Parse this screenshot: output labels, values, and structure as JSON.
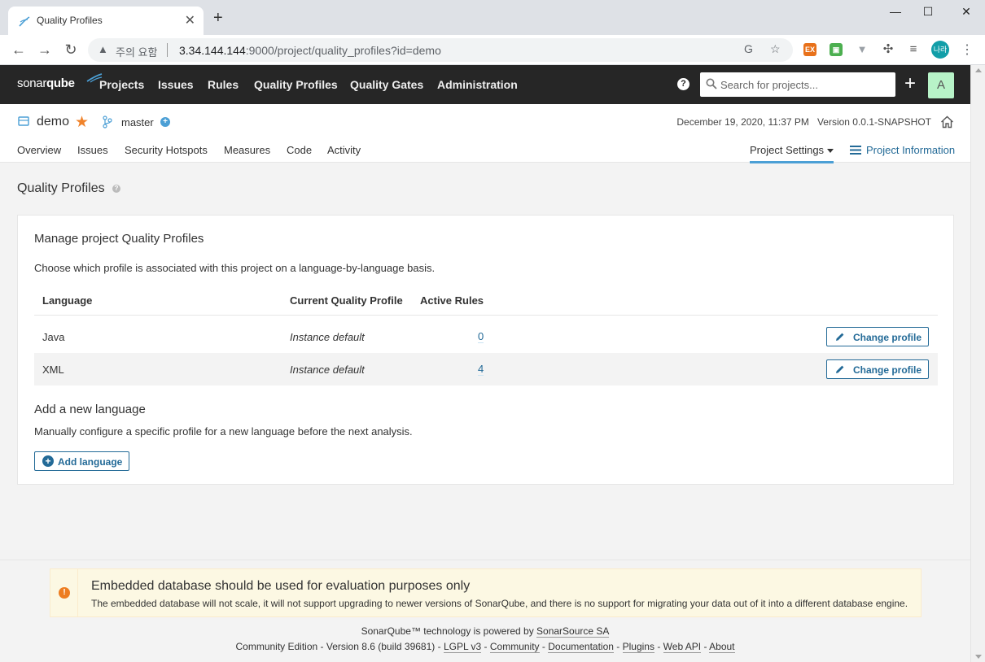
{
  "browser": {
    "tab_title": "Quality Profiles",
    "tab_close": "✕",
    "new_tab": "+",
    "window": {
      "minimize": "—",
      "maximize": "☐",
      "close": "✕"
    },
    "security_label": "주의 요함",
    "url_host": "3.34.144.144",
    "url_rest": ":9000/project/quality_profiles?id=demo",
    "profile_initials": "나라",
    "extensions": [
      {
        "name": "ex-extension-icon",
        "label": "EX",
        "color": "#e8711a"
      },
      {
        "name": "green-extension-icon",
        "label": "▣",
        "color": "#4caf50"
      },
      {
        "name": "vue-extension-icon",
        "label": "▼",
        "color": "#9aa0a6"
      }
    ]
  },
  "navbar": {
    "logo_text_a": "sonar",
    "logo_text_b": "qube",
    "items": [
      "Projects",
      "Issues",
      "Rules",
      "Quality Profiles",
      "Quality Gates",
      "Administration"
    ],
    "help_label": "?",
    "search_placeholder": "Search for projects...",
    "plus_label": "+",
    "avatar_letter": "A"
  },
  "project": {
    "name": "demo",
    "branch": "master",
    "date": "December 19, 2020, 11:37 PM",
    "version": "Version 0.0.1-SNAPSHOT",
    "tabs": [
      "Overview",
      "Issues",
      "Security Hotspots",
      "Measures",
      "Code",
      "Activity"
    ],
    "settings_label": "Project Settings",
    "info_label": "Project Information"
  },
  "page": {
    "title": "Quality Profiles",
    "card_title": "Manage project Quality Profiles",
    "card_desc": "Choose which profile is associated with this project on a language-by-language basis.",
    "columns": [
      "Language",
      "Current Quality Profile",
      "Active Rules"
    ],
    "rows": [
      {
        "language": "Java",
        "profile": "Instance default",
        "rules": "0",
        "action": "Change profile"
      },
      {
        "language": "XML",
        "profile": "Instance default",
        "rules": "4",
        "action": "Change profile"
      }
    ],
    "add_title": "Add a new language",
    "add_desc": "Manually configure a specific profile for a new language before the next analysis.",
    "add_button": "Add language"
  },
  "footer": {
    "warning_icon": "!",
    "warning_title": "Embedded database should be used for evaluation purposes only",
    "warning_text": "The embedded database will not scale, it will not support upgrading to newer versions of SonarQube, and there is no support for migrating your data out of it into a different database engine.",
    "powered_prefix": "SonarQube™ technology is powered by ",
    "powered_link": "SonarSource SA",
    "edition": "Community Edition - Version 8.6 (build 39681) - ",
    "links": [
      "LGPL v3",
      "Community",
      "Documentation",
      "Plugins",
      "Web API",
      "About"
    ]
  },
  "colors": {
    "navbar_bg": "#262626",
    "link_blue": "#236a97",
    "accent_blue": "#4b9fd5",
    "star_orange": "#f0832b",
    "avatar_green": "#b8f3c8",
    "warning_bg": "#fcf8e3"
  }
}
